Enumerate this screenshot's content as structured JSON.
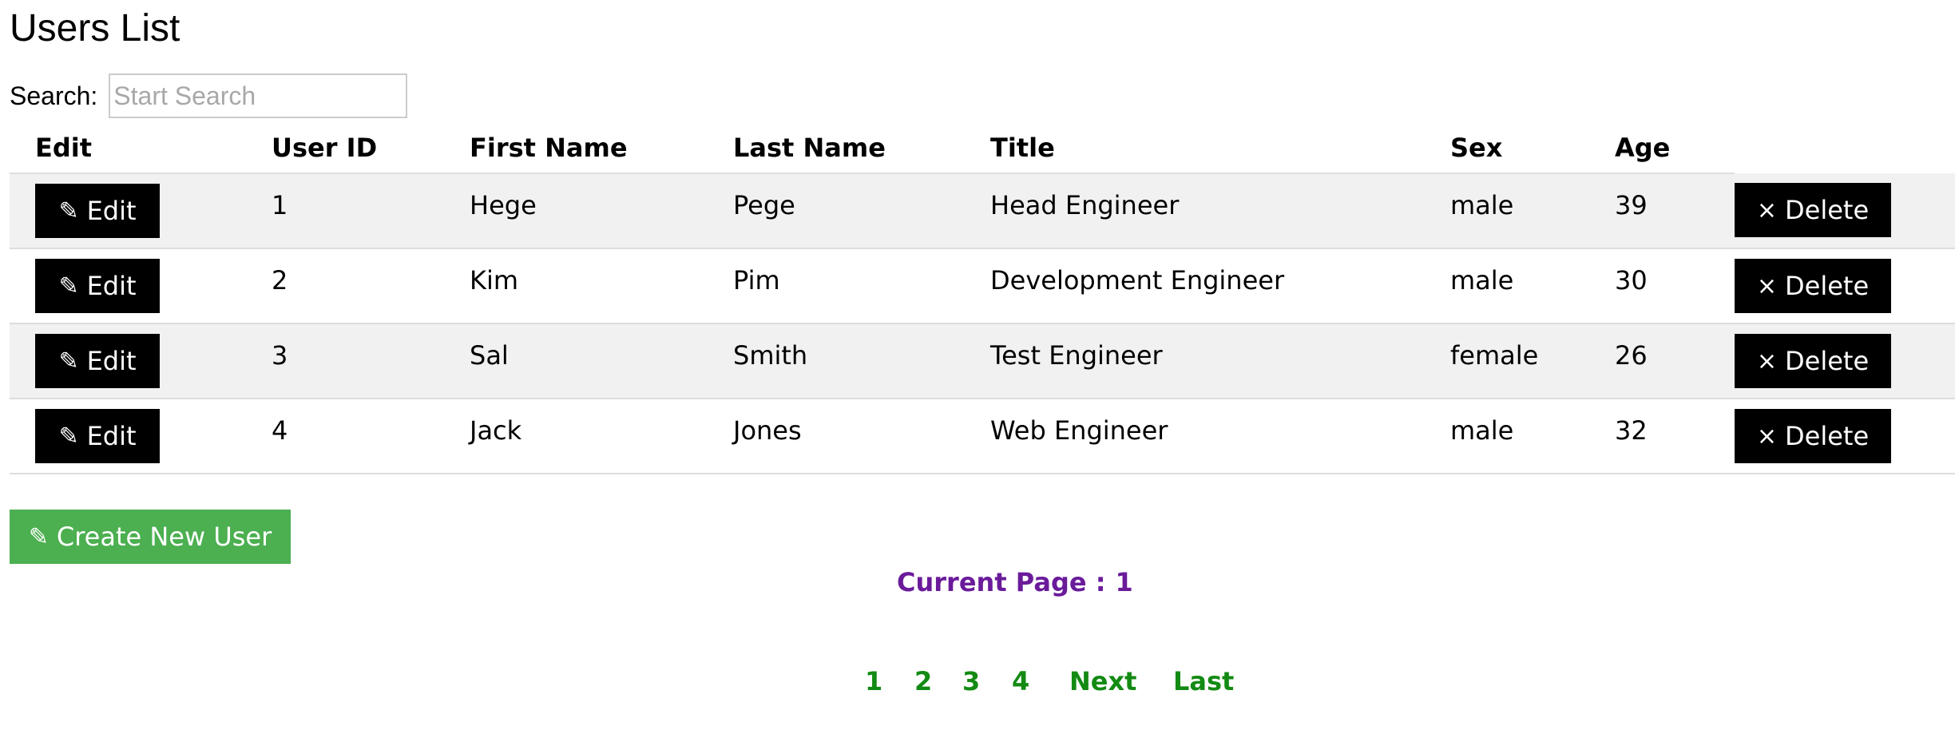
{
  "page": {
    "title": "Users List"
  },
  "search": {
    "label": "Search:",
    "placeholder": "Start Search",
    "value": ""
  },
  "table": {
    "headers": [
      "Edit",
      "User ID",
      "First Name",
      "Last Name",
      "Title",
      "Sex",
      "Age",
      ""
    ],
    "edit_label": "Edit",
    "edit_icon": "✎",
    "delete_label": "Delete",
    "delete_icon": "×",
    "rows": [
      {
        "id": "1",
        "first_name": "Hege",
        "last_name": "Pege",
        "title": "Head Engineer",
        "sex": "male",
        "age": "39"
      },
      {
        "id": "2",
        "first_name": "Kim",
        "last_name": "Pim",
        "title": "Development Engineer",
        "sex": "male",
        "age": "30"
      },
      {
        "id": "3",
        "first_name": "Sal",
        "last_name": "Smith",
        "title": "Test Engineer",
        "sex": "female",
        "age": "26"
      },
      {
        "id": "4",
        "first_name": "Jack",
        "last_name": "Jones",
        "title": "Web Engineer",
        "sex": "male",
        "age": "32"
      }
    ]
  },
  "create_button": {
    "icon": "✎",
    "label": "Create New User"
  },
  "pagination": {
    "current_label": "Current Page :",
    "current_page": "1",
    "pages": [
      "1",
      "2",
      "3",
      "4"
    ],
    "next_label": "Next",
    "last_label": "Last"
  },
  "colors": {
    "create_button_bg": "#4caf50",
    "action_button_bg": "#000000",
    "current_page_text": "#6a1b9a",
    "pagination_link": "#138a13",
    "striped_row_bg": "#f1f1f1"
  },
  "icons": {
    "edit": "pencil-icon",
    "delete": "close-icon"
  }
}
